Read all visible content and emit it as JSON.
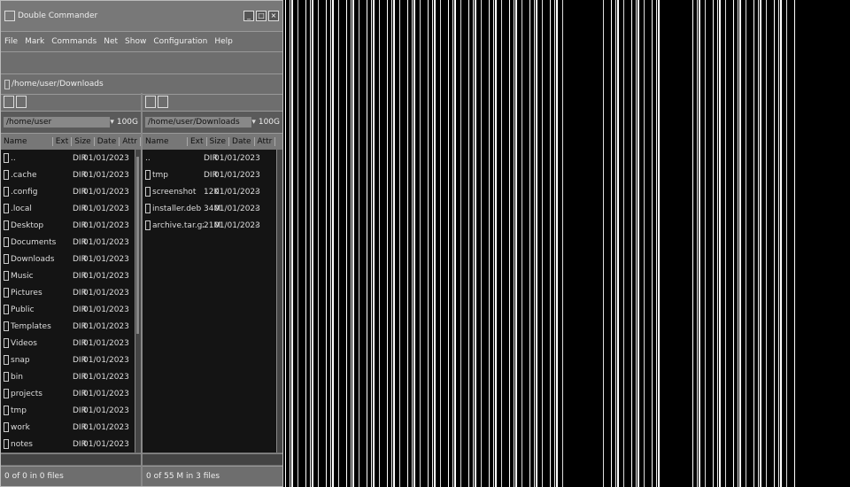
{
  "window": {
    "title": "Double Commander"
  },
  "menubar": [
    "File",
    "Mark",
    "Commands",
    "Net",
    "Show",
    "Configuration",
    "Help"
  ],
  "pathbar": {
    "text": "/home/user/Downloads"
  },
  "left": {
    "drive": "/home/user",
    "free": "100G",
    "columns": [
      "Name",
      "Ext",
      "Size",
      "Date",
      "Attr"
    ],
    "rows": [
      {
        "name": "..",
        "ext": "",
        "size": "DIR",
        "date": "01/01/2023",
        "attr": ""
      },
      {
        "name": ".cache",
        "ext": "",
        "size": "DIR",
        "date": "01/01/2023",
        "attr": ""
      },
      {
        "name": ".config",
        "ext": "",
        "size": "DIR",
        "date": "01/01/2023",
        "attr": ""
      },
      {
        "name": ".local",
        "ext": "",
        "size": "DIR",
        "date": "01/01/2023",
        "attr": ""
      },
      {
        "name": "Desktop",
        "ext": "",
        "size": "DIR",
        "date": "01/01/2023",
        "attr": ""
      },
      {
        "name": "Documents",
        "ext": "",
        "size": "DIR",
        "date": "01/01/2023",
        "attr": ""
      },
      {
        "name": "Downloads",
        "ext": "",
        "size": "DIR",
        "date": "01/01/2023",
        "attr": ""
      },
      {
        "name": "Music",
        "ext": "",
        "size": "DIR",
        "date": "01/01/2023",
        "attr": ""
      },
      {
        "name": "Pictures",
        "ext": "",
        "size": "DIR",
        "date": "01/01/2023",
        "attr": ""
      },
      {
        "name": "Public",
        "ext": "",
        "size": "DIR",
        "date": "01/01/2023",
        "attr": ""
      },
      {
        "name": "Templates",
        "ext": "",
        "size": "DIR",
        "date": "01/01/2023",
        "attr": ""
      },
      {
        "name": "Videos",
        "ext": "",
        "size": "DIR",
        "date": "01/01/2023",
        "attr": ""
      },
      {
        "name": "snap",
        "ext": "",
        "size": "DIR",
        "date": "01/01/2023",
        "attr": ""
      },
      {
        "name": "bin",
        "ext": "",
        "size": "DIR",
        "date": "01/01/2023",
        "attr": ""
      },
      {
        "name": "projects",
        "ext": "",
        "size": "DIR",
        "date": "01/01/2023",
        "attr": ""
      },
      {
        "name": "tmp",
        "ext": "",
        "size": "DIR",
        "date": "01/01/2023",
        "attr": ""
      },
      {
        "name": "work",
        "ext": "",
        "size": "DIR",
        "date": "01/01/2023",
        "attr": ""
      },
      {
        "name": "notes",
        "ext": "",
        "size": "DIR",
        "date": "01/01/2023",
        "attr": ""
      }
    ],
    "status": "0 of 0 in 0 files"
  },
  "right": {
    "drive": "/home/user/Downloads",
    "free": "100G",
    "columns": [
      "Name",
      "Ext",
      "Size",
      "Date",
      "Attr"
    ],
    "rows": [
      {
        "name": "..",
        "ext": "",
        "size": "DIR",
        "date": "01/01/2023",
        "attr": ""
      },
      {
        "name": "tmp",
        "ext": "",
        "size": "DIR",
        "date": "01/01/2023",
        "attr": ""
      },
      {
        "name": "screenshot",
        "ext": "",
        "size": "12K",
        "date": "01/01/2023",
        "attr": "-"
      },
      {
        "name": "installer.deb",
        "ext": "",
        "size": "34M",
        "date": "01/01/2023",
        "attr": "-"
      },
      {
        "name": "archive.tar.gz",
        "ext": "",
        "size": "21M",
        "date": "01/01/2023",
        "attr": "-"
      }
    ],
    "status": "0 of 55 M in 3 files"
  },
  "colors": {
    "stripes": "#000000",
    "window_bg": "#6e6e6e",
    "list_bg": "#141414"
  }
}
